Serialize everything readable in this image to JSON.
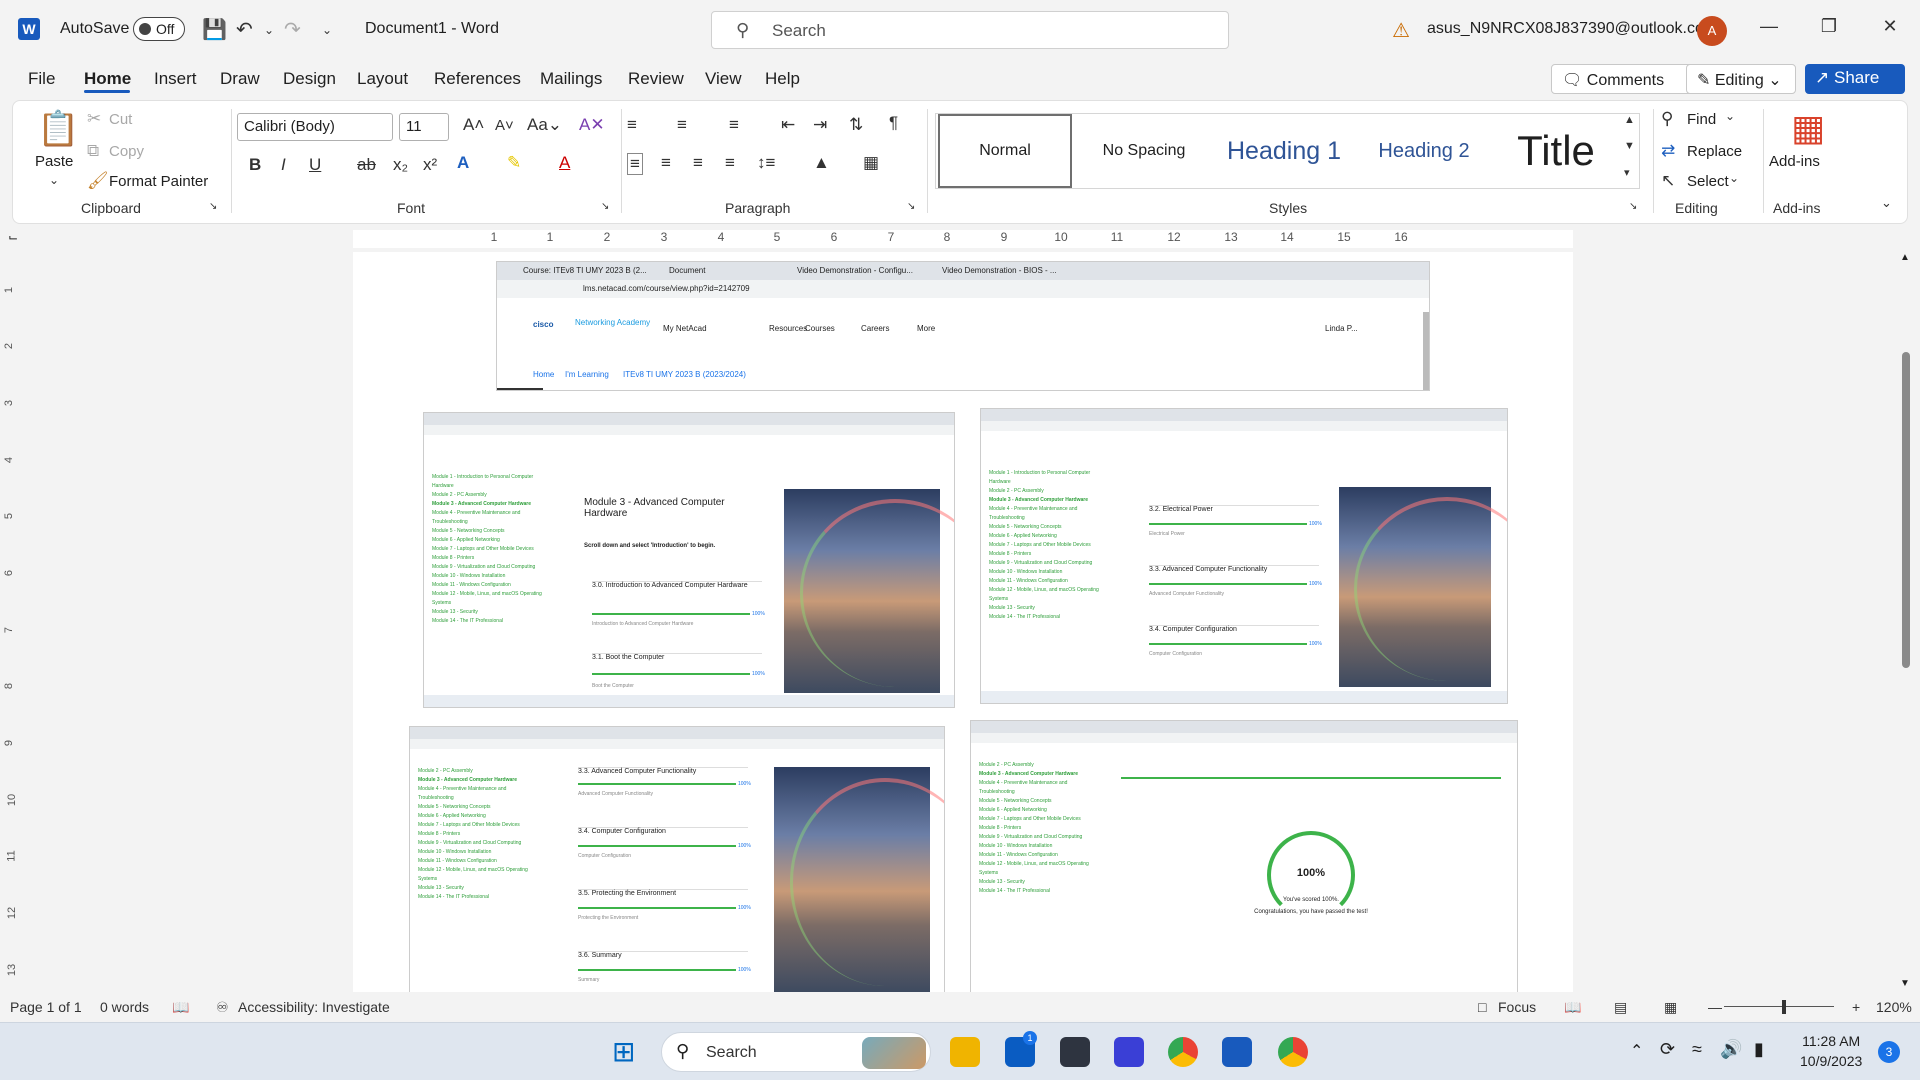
{
  "titlebar": {
    "autosave_label": "AutoSave",
    "autosave_state": "Off",
    "doc_title": "Document1  -  Word",
    "search_placeholder": "Search",
    "account": "asus_N9NRCX08J837390@outlook.com",
    "avatar_initial": "A"
  },
  "tabs": [
    "File",
    "Home",
    "Insert",
    "Draw",
    "Design",
    "Layout",
    "References",
    "Mailings",
    "Review",
    "View",
    "Help"
  ],
  "actions": {
    "comments": "Comments",
    "editing": "Editing",
    "share": "Share"
  },
  "ribbon": {
    "clipboard": {
      "label": "Clipboard",
      "paste": "Paste",
      "cut": "Cut",
      "copy": "Copy",
      "format_painter": "Format Painter"
    },
    "font": {
      "label": "Font",
      "font_name": "Calibri (Body)",
      "font_size": "11"
    },
    "paragraph": {
      "label": "Paragraph"
    },
    "styles": {
      "label": "Styles",
      "items": [
        "Normal",
        "No Spacing",
        "Heading 1",
        "Heading 2",
        "Title"
      ]
    },
    "editing": {
      "label": "Editing",
      "find": "Find",
      "replace": "Replace",
      "select": "Select"
    },
    "addins": {
      "label": "Add-ins",
      "button": "Add-ins"
    }
  },
  "ruler": {
    "numbers": [
      "1",
      "1",
      "2",
      "3",
      "4",
      "5",
      "6",
      "7",
      "8",
      "9",
      "10",
      "11",
      "12",
      "13",
      "14",
      "15",
      "16"
    ]
  },
  "v_ruler": {
    "numbers": [
      "1",
      "2",
      "3",
      "4",
      "5",
      "6",
      "7",
      "8",
      "9",
      "10",
      "11",
      "12",
      "13"
    ]
  },
  "embedded": {
    "top_browser": {
      "tabs": [
        "Course: ITEv8 TI UMY 2023 B (2...",
        "Document",
        "Video Demonstration - Configu...",
        "Video Demonstration - BIOS - ..."
      ],
      "url": "lms.netacad.com/course/view.php?id=2142709",
      "logo_text": "Networking Academy",
      "nav": [
        "My NetAcad",
        "Resources",
        "Courses",
        "Careers",
        "More"
      ],
      "user": "Linda P...",
      "breadcrumb": [
        "Home",
        "I'm Learning",
        "ITEv8 TI UMY 2023 B (2023/2024)"
      ]
    },
    "modules": [
      "Module 1 - Introduction to Personal Computer Hardware",
      "Module 2 - PC Assembly",
      "Module 3 - Advanced Computer Hardware",
      "Module 4 - Preventive Maintenance and Troubleshooting",
      "Module 5 - Networking Concepts",
      "Module 6 - Applied Networking",
      "Module 7 - Laptops and Other Mobile Devices",
      "Module 8 - Printers",
      "Module 9 - Virtualization and Cloud Computing",
      "Module 10 - Windows Installation",
      "Module 11 - Windows Configuration",
      "Module 12 - Mobile, Linux, and macOS Operating Systems",
      "Module 13 - Security",
      "Module 14 - The IT Professional"
    ],
    "shot1": {
      "title": "Module 3 - Advanced Computer Hardware",
      "hint": "Scroll down and select 'Introduction' to begin.",
      "cards": [
        {
          "title": "3.0. Introduction to Advanced Computer Hardware",
          "sub": "Introduction to Advanced Computer Hardware"
        },
        {
          "title": "3.1. Boot the Computer",
          "sub": "Boot the Computer"
        }
      ]
    },
    "shot2": {
      "cards": [
        {
          "title": "3.2. Electrical Power",
          "sub": "Electrical Power"
        },
        {
          "title": "3.3. Advanced Computer Functionality",
          "sub": "Advanced Computer Functionality"
        },
        {
          "title": "3.4. Computer Configuration",
          "sub": "Computer Configuration"
        }
      ]
    },
    "shot3": {
      "cards": [
        {
          "title": "3.3. Advanced Computer Functionality",
          "sub": "Advanced Computer Functionality"
        },
        {
          "title": "3.4. Computer Configuration",
          "sub": "Computer Configuration"
        },
        {
          "title": "3.5. Protecting the Environment",
          "sub": "Protecting the Environment"
        },
        {
          "title": "3.6. Summary",
          "sub": "Summary"
        }
      ]
    },
    "shot4": {
      "score": "100%",
      "msg1": "You've scored 100%.",
      "msg2": "Congratulations, you have passed the test!"
    },
    "progress_pct": "100%"
  },
  "statusbar": {
    "page": "Page 1 of 1",
    "words": "0 words",
    "accessibility": "Accessibility: Investigate",
    "focus": "Focus",
    "zoom": "120%"
  },
  "taskbar": {
    "search": "Search",
    "time": "11:28 AM",
    "date": "10/9/2023",
    "badge": "3",
    "store_badge": "1"
  }
}
